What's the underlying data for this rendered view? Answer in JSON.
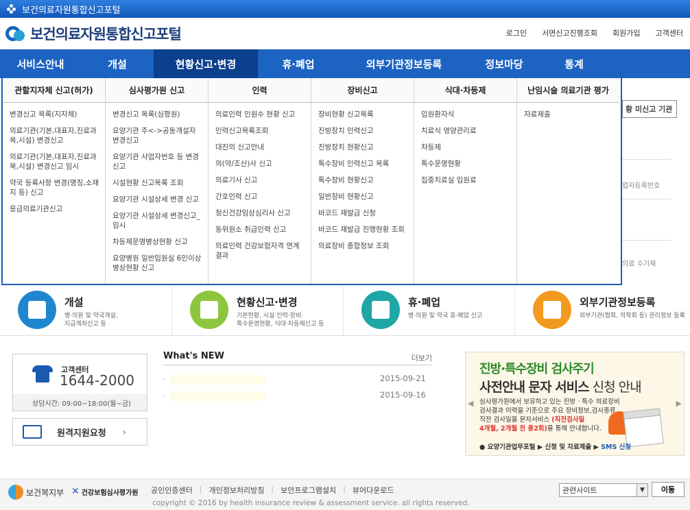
{
  "window": {
    "title": "보건의료자원통합신고포털"
  },
  "header": {
    "logo_text": "보건의료자원통합신고포털",
    "util_links": [
      "로그인",
      "서면신고진행조회",
      "회원가입",
      "고객센터"
    ]
  },
  "gnb": {
    "items": [
      "서비스안내",
      "개설",
      "현황신고·변경",
      "휴·폐업",
      "외부기관정보등록",
      "정보마당",
      "통계"
    ],
    "active_index": 2
  },
  "mega": {
    "columns": [
      {
        "title": "관할지자체 신고(허가)",
        "items": [
          "변경신고 목록(지자체)",
          "의료기관(기본,대표자,진료과목,시설) 변경신고",
          "의료기관(기본,대표자,진료과목,시설) 변경신고 임시",
          "약국 등록사항 변경(명칭,소재지 등) 신고",
          "응급의료기관신고"
        ]
      },
      {
        "title": "심사평가원 신고",
        "items": [
          "변경신고 목록(심평원)",
          "요양기관 주<->공동개설자 변경신고",
          "요양기관 사업자번호 등 변경신고",
          "시설현황 신고목록 조회",
          "요양기관 시설상세 변경 신고",
          "요양기관 시설상세 변경신고_임시",
          "차등제운영병상현황 신고",
          "요양병원 일반입원실 6인이상 병상현황 신고"
        ]
      },
      {
        "title": "인력",
        "items": [
          "의료인력 인원수 현황 신고",
          "인력신고목록조회",
          "대진의 신고안내",
          "의(약/조산)사 신고",
          "의료기사 신고",
          "간호인력 신고",
          "정신건강임상심리사 신고",
          "동위원소 취급인력 신고",
          "의료인력 건강보험자격 연계결과"
        ]
      },
      {
        "title": "장비신고",
        "items": [
          "장비현황 신고목록",
          "진방장치 인력신고",
          "진방장치 현황신고",
          "특수장비 인력신고 목록",
          "특수장비 현황신고",
          "일반장비 현황신고",
          "바코드 재발급 신청",
          "바코드 재발급 진행현황 조회",
          "의료장비 종합정보 조회"
        ]
      },
      {
        "title": "식대·차등제",
        "items": [
          "입원환자식",
          "치료식 영양관리료",
          "차등제",
          "특수운영현황",
          "집중치료실 입원료"
        ]
      },
      {
        "title": "난임시술 의료기관 평가",
        "items": [
          "자료제출"
        ]
      }
    ]
  },
  "background_peek": {
    "box_label": "황 미신고 기관",
    "text1": "업자등록번호",
    "text2": "의료 수기재"
  },
  "quick_menu": [
    {
      "title": "개설",
      "desc": [
        "병·의원 및 약국개설,",
        "지급계좌신고 등"
      ],
      "color": "#1f86d0"
    },
    {
      "title": "현황신고·변경",
      "desc": [
        "기본현황, 시설·인력·장비·",
        "특수운영현황, 식대·차등제신고 등"
      ],
      "color": "#8cc63f"
    },
    {
      "title": "휴·폐업",
      "desc": [
        "병·의원 및 약국 휴·폐업 신고"
      ],
      "color": "#1fa6a6"
    },
    {
      "title": "외부기관정보등록",
      "desc": [
        "외부기관(협회, 의학회 등) 관리정보 등록"
      ],
      "color": "#f29a1f"
    }
  ],
  "customer_center": {
    "label": "고객센터",
    "number": "1644-2000",
    "hours": "상담시간: 09:00~18:00(월~금)"
  },
  "remote_support": {
    "label": "원격지원요청"
  },
  "news": {
    "title": "What's NEW",
    "more": "더보기",
    "items": [
      {
        "date": "2015-09-21"
      },
      {
        "date": "2015-09-16"
      }
    ]
  },
  "banner": {
    "line1": "진방·특수장비 검사주기",
    "line2_bold": "사전안내 문자 서비스",
    "line2_normal": " 신청 안내",
    "desc1": "심사평가원에서 보유하고 있는 진방 · 특수 의료장비 검사결과 이력을 기준으로 주요 장비정보,검사종류, 직전 검사일을 문자서비스 ",
    "desc_red1": "(직전검사일",
    "desc_red2": "4개월, 2개월 전 총2회)",
    "desc2": "를 통해 안내합니다.",
    "path_prefix": "요양기관업무포털 ▶ 신청 및 자료제출 ▶ ",
    "path_sms": "SMS 신청",
    "prev": "◀",
    "next": "▶"
  },
  "footer": {
    "logo1": "보건복지부",
    "logo2": "건강보험심사평가원",
    "links": [
      "공인인증센터",
      "개인정보처리방침",
      "보안프로그램설치",
      "뷰어다운로드"
    ],
    "copyright": "copyright © 2016 by health insurance review & assessment service. all rights reserved.",
    "select_value": "관련사이트",
    "go_button": "이동"
  }
}
